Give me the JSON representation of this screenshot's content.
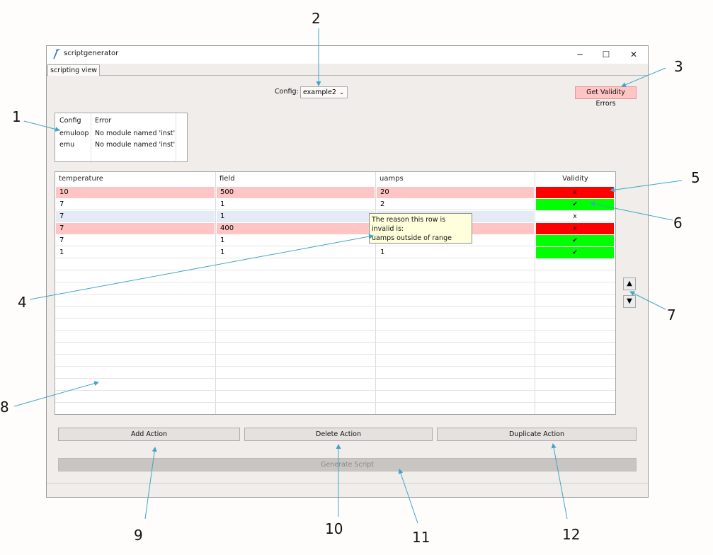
{
  "window": {
    "title": "scriptgenerator",
    "minimize_glyph": "─",
    "maximize_glyph": "☐",
    "close_glyph": "✕"
  },
  "tabs": [
    "scripting view"
  ],
  "config": {
    "label": "Config:",
    "value": "example2"
  },
  "validity_errors_button": "Get Validity Errors",
  "error_table": {
    "headers": [
      "Config",
      "Error"
    ],
    "rows": [
      [
        "emuloop",
        "No module named 'inst'"
      ],
      [
        "emu",
        "No module named 'inst'"
      ]
    ]
  },
  "actions_table": {
    "headers": [
      "temperature",
      "field",
      "uamps",
      "Validity"
    ],
    "rows": [
      {
        "temperature": "10",
        "field": "500",
        "uamps": "20",
        "valid": false,
        "mark": "x",
        "highlight": "invalid"
      },
      {
        "temperature": "7",
        "field": "1",
        "uamps": "2",
        "valid": true,
        "mark": "✔",
        "highlight": "none"
      },
      {
        "temperature": "7",
        "field": "1",
        "uamps": "",
        "valid": null,
        "mark": "x",
        "highlight": "selected"
      },
      {
        "temperature": "7",
        "field": "400",
        "uamps": "",
        "valid": false,
        "mark": "x",
        "highlight": "invalid"
      },
      {
        "temperature": "7",
        "field": "1",
        "uamps": "",
        "valid": true,
        "mark": "✔",
        "highlight": "none"
      },
      {
        "temperature": "1",
        "field": "1",
        "uamps": "1",
        "valid": true,
        "mark": "✔",
        "highlight": "none"
      }
    ]
  },
  "tooltip": {
    "line1": "The reason this row is invalid is:",
    "line2": "uamps outside of range"
  },
  "side_buttons": {
    "up": "▲",
    "down": "▼"
  },
  "buttons": {
    "add": "Add Action",
    "delete": "Delete Action",
    "duplicate": "Duplicate Action",
    "generate": "Generate Script"
  },
  "callouts": [
    "1",
    "2",
    "3",
    "4",
    "5",
    "6",
    "7",
    "8",
    "9",
    "10",
    "11",
    "12"
  ],
  "colors": {
    "invalid_row": "#ffc4c4",
    "selected_row": "#e4ebf5",
    "valid_green": "#00ff00",
    "invalid_red": "#ff0000",
    "callout_line": "#3ea6c6"
  }
}
